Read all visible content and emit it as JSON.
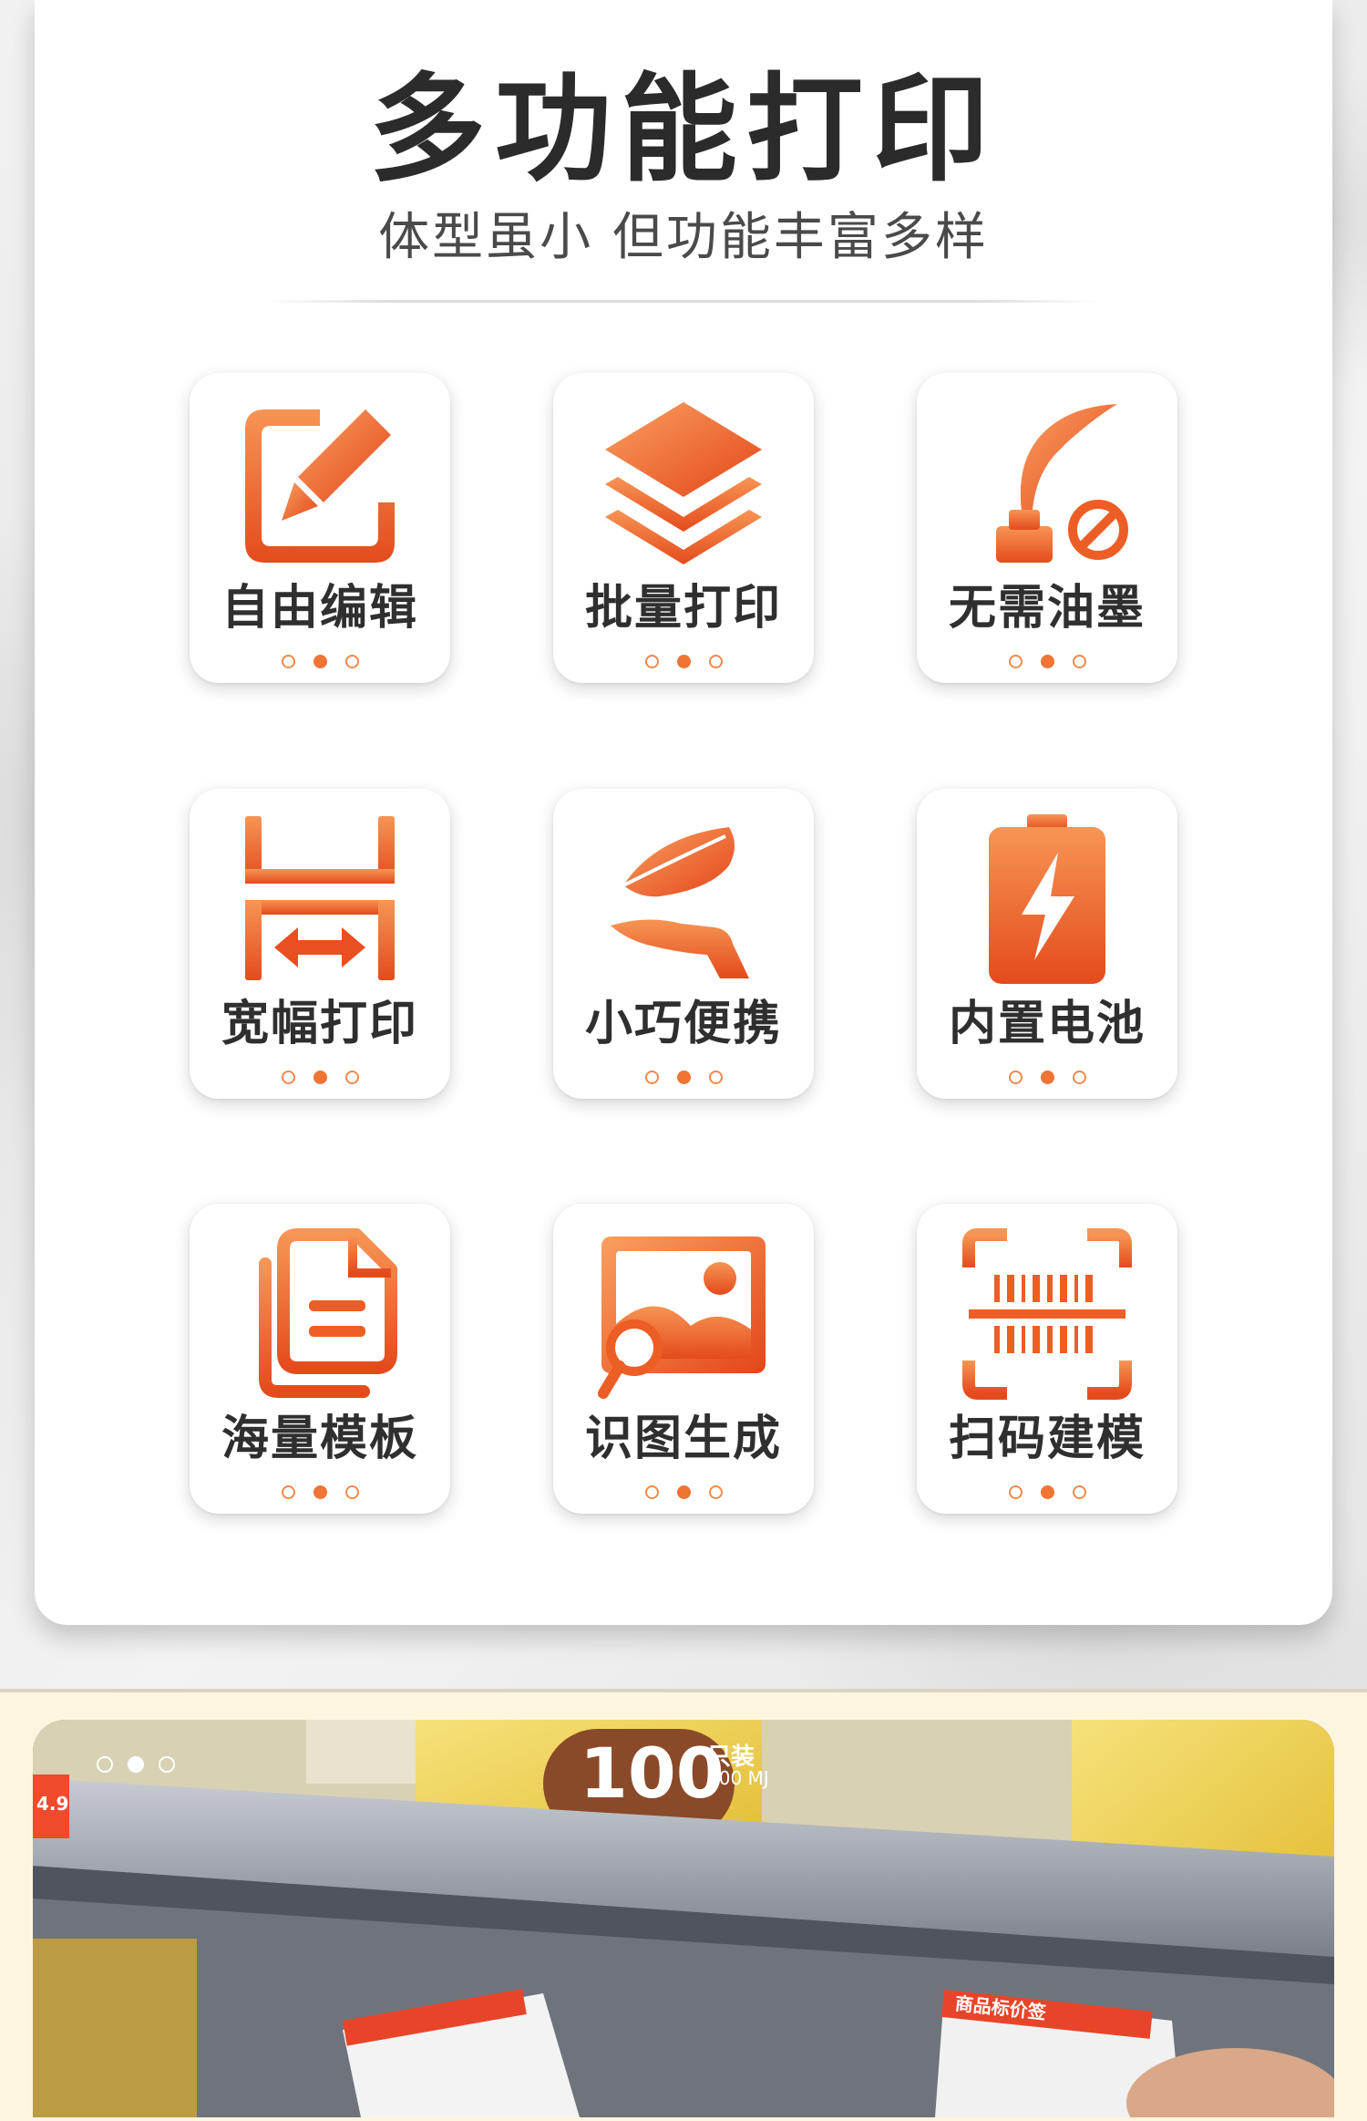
{
  "header": {
    "title": "多功能打印",
    "subtitle": "体型虽小 但功能丰富多样"
  },
  "accent_color": "#f07434",
  "features": [
    {
      "label": "自由编辑",
      "icon": "edit-pencil-icon"
    },
    {
      "label": "批量打印",
      "icon": "layers-stack-icon"
    },
    {
      "label": "无需油墨",
      "icon": "no-ink-quill-icon"
    },
    {
      "label": "宽幅打印",
      "icon": "wide-width-icon"
    },
    {
      "label": "小巧便携",
      "icon": "feather-hand-icon"
    },
    {
      "label": "内置电池",
      "icon": "battery-charging-icon"
    },
    {
      "label": "海量模板",
      "icon": "templates-documents-icon"
    },
    {
      "label": "识图生成",
      "icon": "image-recognition-icon"
    },
    {
      "label": "扫码建模",
      "icon": "barcode-scan-icon"
    }
  ],
  "carousel": {
    "active_index": 1,
    "count": 3
  },
  "photo_labels": {
    "bag_number": "100",
    "bag_text": "只装",
    "bag_sub": "200 MJ",
    "price_tag_title": "商品标价签",
    "price_tag_left": "4.9"
  }
}
